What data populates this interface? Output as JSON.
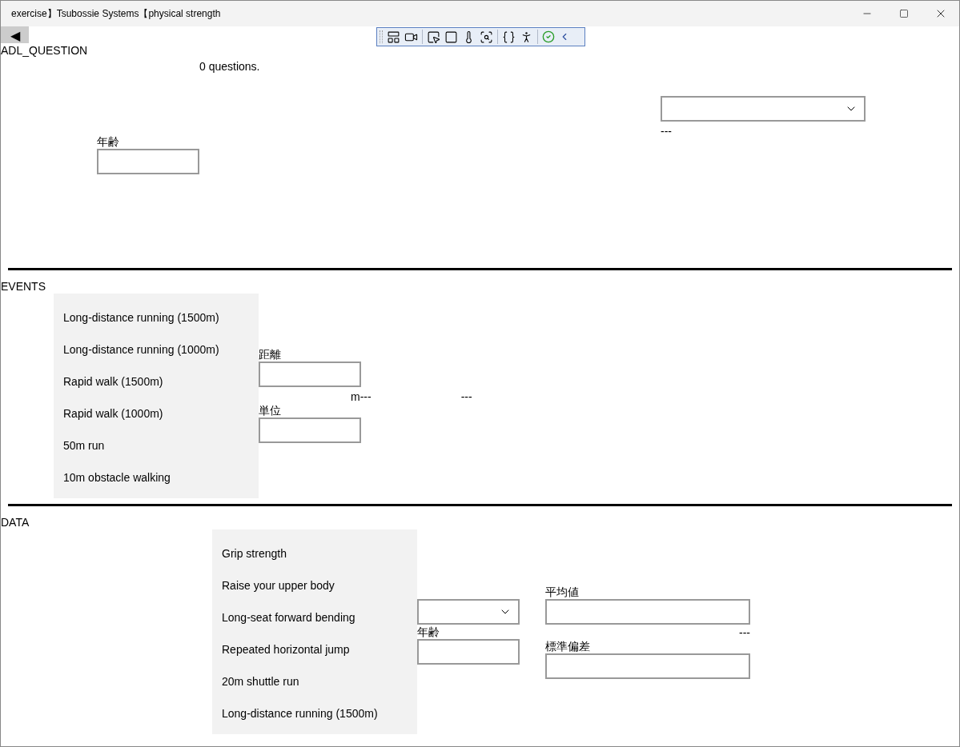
{
  "window": {
    "title": "exercise】Tsubossie Systems【physical strength"
  },
  "back_button": {
    "label": "◀"
  },
  "adl_question": {
    "heading": "ADL_QUESTION",
    "count": "0 questions.",
    "dropdown_note": "---",
    "age_label": "年齢"
  },
  "events": {
    "heading": "EVENTS",
    "items": [
      {
        "label": "Long-distance running (1500m)",
        "selected": false
      },
      {
        "label": "Long-distance running (1000m)",
        "selected": false
      },
      {
        "label": "Rapid walk (1500m)",
        "selected": false
      },
      {
        "label": "Rapid walk (1000m)",
        "selected": false
      },
      {
        "label": "50m run",
        "selected": false
      },
      {
        "label": "10m obstacle walking",
        "selected": false
      }
    ],
    "distance_label": "距離",
    "unit_text": "m---",
    "extra_text": "---",
    "unit_label": "単位"
  },
  "data": {
    "heading": "DATA",
    "items": [
      {
        "label": "Grip strength",
        "selected": false
      },
      {
        "label": "Raise your upper body",
        "selected": false
      },
      {
        "label": "Long-seat forward bending",
        "selected": false
      },
      {
        "label": "Repeated horizontal jump",
        "selected": false
      },
      {
        "label": "20m shuttle run",
        "selected": false
      },
      {
        "label": "Long-distance running (1500m)",
        "selected": false
      }
    ],
    "age_label": "年齢",
    "mean_label": "平均値",
    "mean_note": "---",
    "sd_label": "標準偏差"
  }
}
